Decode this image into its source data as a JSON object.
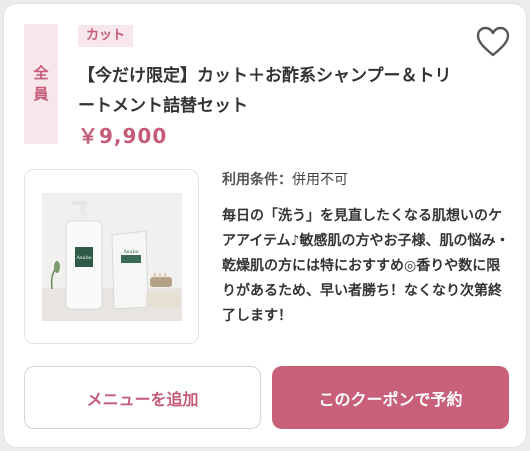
{
  "coupon": {
    "target_label_1": "全",
    "target_label_2": "員",
    "category_tag": "カット",
    "title": "【今だけ限定】カット＋お酢系シャンプー＆トリートメント詰替セット",
    "price": "￥9,900",
    "condition_label": "利用条件：",
    "condition_value": "併用不可",
    "description": "毎日の「洗う」を見直したくなる肌想いのケアアイテム♪敏感肌の方やお子様、肌の悩み・乾燥肌の方には特におすすめ◎香りや数に限りがあるため、早い者勝ち！なくなり次第終了します！",
    "product_label_bottle": "Asabo",
    "product_label_pouch": "Asabo"
  },
  "actions": {
    "add_menu_label": "メニューを追加",
    "reserve_label": "このクーポンで予約"
  },
  "icons": {
    "favorite": "heart-outline-icon"
  },
  "colors": {
    "accent": "#c45c78",
    "accent_bg": "#f7e6ea",
    "button_primary": "#c8607a"
  }
}
